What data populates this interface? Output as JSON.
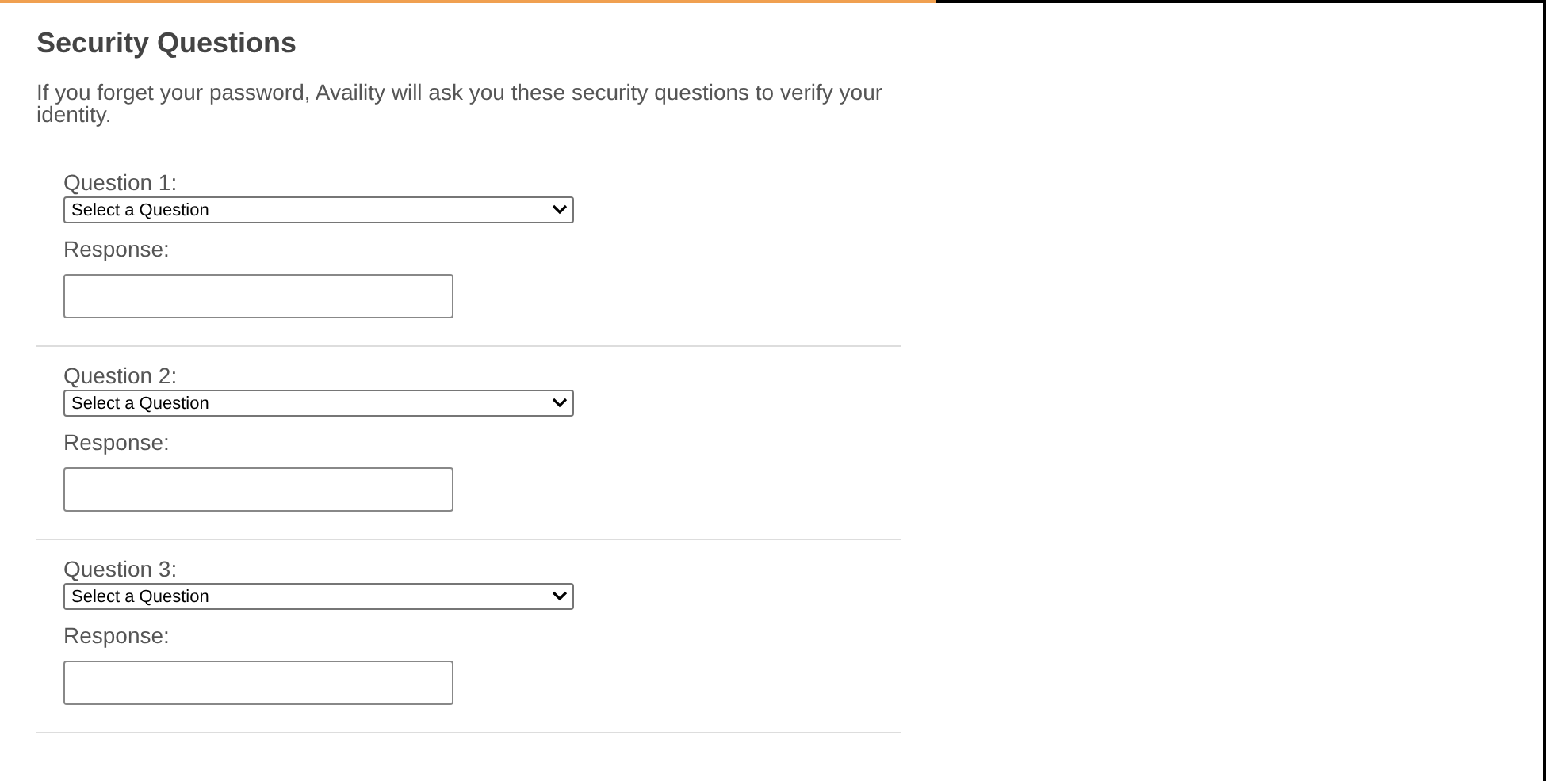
{
  "title": "Security Questions",
  "intro": "If you forget your password, Availity will ask you these security questions to verify your identity.",
  "questions": [
    {
      "label": "Question 1:",
      "dropdown_value": "Select a Question",
      "response_label": "Response:"
    },
    {
      "label": "Question 2:",
      "dropdown_value": "Select a Question",
      "response_label": "Response:"
    },
    {
      "label": "Question 3:",
      "dropdown_value": "Select a Question",
      "response_label": "Response:"
    }
  ]
}
